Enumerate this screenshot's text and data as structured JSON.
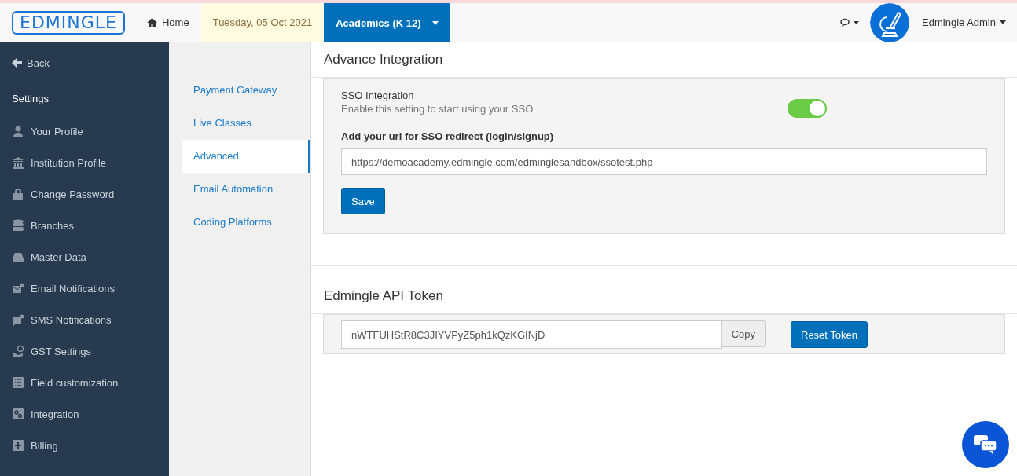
{
  "header": {
    "logo": "EDMINGLE",
    "home": "Home",
    "date": "Tuesday, 05 Oct 2021",
    "academics": {
      "label": "Academics (K 12)",
      "selected": true
    },
    "user": "Edmingle Admin"
  },
  "sidebar": {
    "back": "Back",
    "heading": "Settings",
    "items": [
      {
        "label": "Your Profile"
      },
      {
        "label": "Institution Profile"
      },
      {
        "label": "Change Password"
      },
      {
        "label": "Branches"
      },
      {
        "label": "Master Data"
      },
      {
        "label": "Email Notifications"
      },
      {
        "label": "SMS Notifications"
      },
      {
        "label": "GST Settings"
      },
      {
        "label": "Field customization"
      },
      {
        "label": "Integration"
      },
      {
        "label": "Billing"
      }
    ]
  },
  "subnav": [
    {
      "label": "Payment Gateway",
      "selected": false
    },
    {
      "label": "Live Classes",
      "selected": false
    },
    {
      "label": "Advanced",
      "selected": true
    },
    {
      "label": "Email Automation",
      "selected": false
    },
    {
      "label": "Coding Platforms",
      "selected": false
    }
  ],
  "advance": {
    "title": "Advance Integration",
    "sso_title": "SSO Integration",
    "sso_desc": "Enable this setting to start using your SSO",
    "sso_on": true,
    "url_label": "Add your url for SSO redirect (login/signup)",
    "url_value": "https://demoacademy.edmingle.com/edminglesandbox/ssotest.php",
    "save": "Save"
  },
  "token": {
    "title": "Edmingle API Token",
    "value": "nWTFUHStR8C3JIYVPyZ5ph1kQzKGINjD",
    "copy": "Copy",
    "reset": "Reset Token"
  }
}
